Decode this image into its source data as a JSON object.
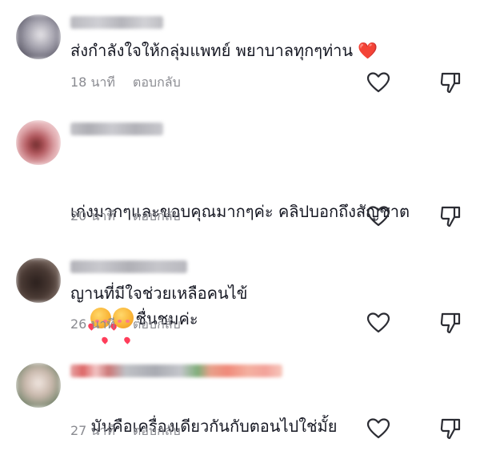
{
  "icons": {
    "like": "heart-outline-icon",
    "dislike": "thumbs-down-icon"
  },
  "colors": {
    "text": "#161823",
    "meta": "#8a8b91",
    "heart": "#ee1d52"
  },
  "comments": [
    {
      "text": "ส่งกำลังใจให้กลุ่มแพทย์ พยาบาลทุกๆท่าน",
      "emoji_suffix": "❤️",
      "time": "18 นาที",
      "reply": "ตอบกลับ"
    },
    {
      "text": "เก่งมากๆและขอบคุณมากๆค่ะ คลิปบอกถึงสัญชาตญานที่มีใจช่วยเหลือคนไข้",
      "text_line1": "เก่งมากๆและขอบคุณมากๆค่ะ คลิปบอกถึงสัญชาต",
      "text_line2": "ญานที่มีใจช่วยเหลือคนไข้",
      "time": "20 นาที",
      "reply": "ตอบกลับ"
    },
    {
      "text": "ชื่นชมค่ะ",
      "emoji_prefix": "🥰🥰",
      "time": "26 นาที",
      "reply": "ตอบกลับ"
    },
    {
      "text": "มันคือเครื่องเดียวกันกับตอนไปใช่มั้ย",
      "time": "27 นาที",
      "reply": "ตอบกลับ"
    }
  ]
}
